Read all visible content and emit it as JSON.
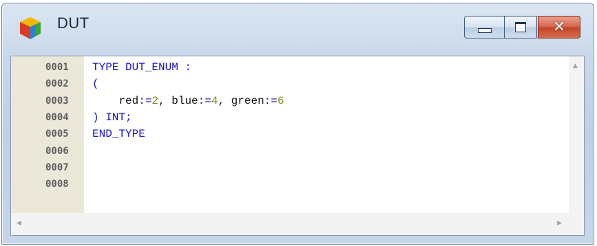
{
  "window": {
    "title": "DUT",
    "icon": "cube-icon"
  },
  "controls": {
    "minimize_icon": "minimize-icon",
    "maximize_icon": "maximize-icon",
    "close_label": "✕"
  },
  "editor": {
    "lines": [
      {
        "no": "0001",
        "tokens": [
          {
            "t": "TYPE DUT_ENUM :",
            "c": "kw"
          }
        ]
      },
      {
        "no": "0002",
        "tokens": [
          {
            "t": "(",
            "c": "op"
          }
        ]
      },
      {
        "no": "0003",
        "tokens": [
          {
            "t": "    red",
            "c": "plain"
          },
          {
            "t": ":=",
            "c": "op"
          },
          {
            "t": "2",
            "c": "num"
          },
          {
            "t": ", ",
            "c": "plain"
          },
          {
            "t": "blue",
            "c": "plain"
          },
          {
            "t": ":=",
            "c": "op"
          },
          {
            "t": "4",
            "c": "num"
          },
          {
            "t": ", ",
            "c": "plain"
          },
          {
            "t": "green",
            "c": "plain"
          },
          {
            "t": ":=",
            "c": "op"
          },
          {
            "t": "6",
            "c": "num"
          }
        ]
      },
      {
        "no": "0004",
        "tokens": [
          {
            "t": ") INT;",
            "c": "kw"
          }
        ]
      },
      {
        "no": "0005",
        "tokens": [
          {
            "t": "END_TYPE",
            "c": "kw"
          }
        ]
      },
      {
        "no": "0006",
        "tokens": []
      },
      {
        "no": "0007",
        "tokens": []
      },
      {
        "no": "0008",
        "tokens": []
      }
    ]
  },
  "colors": {
    "keyword": "#1a17b4",
    "number": "#7a8c1c",
    "gutter": "#ebe8da"
  }
}
